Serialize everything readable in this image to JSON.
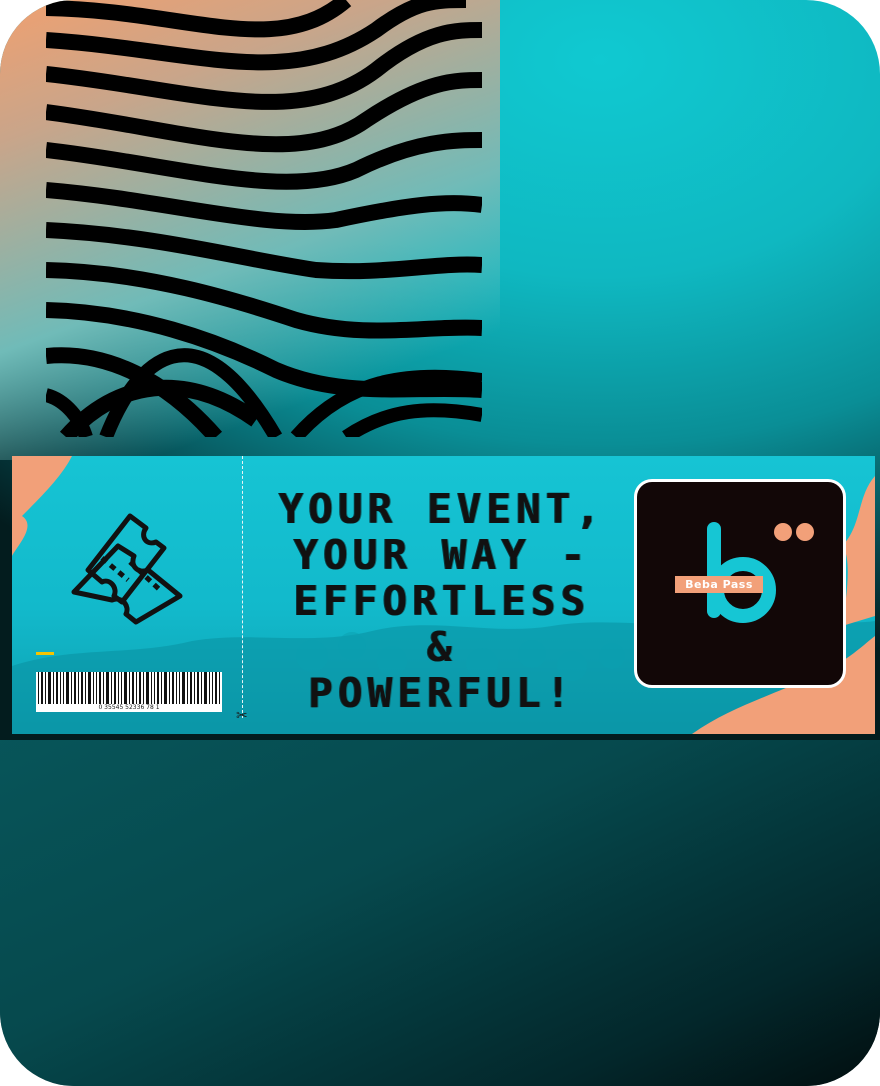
{
  "headline": {
    "line1": "YOUR EVENT,",
    "line2": "YOUR WAY -",
    "line3": "EFFORTLESS",
    "line4": "&",
    "line5": "POWERFUL!"
  },
  "brand": {
    "name": "Beba Pass"
  },
  "barcode": {
    "number": "0 35545 52336 78 1"
  },
  "colors": {
    "accent": "#12c3d0",
    "orange": "#f2a079",
    "dark": "#120707"
  },
  "icons": {
    "ticket": "ticket-icon",
    "scissors": "scissors-icon"
  }
}
